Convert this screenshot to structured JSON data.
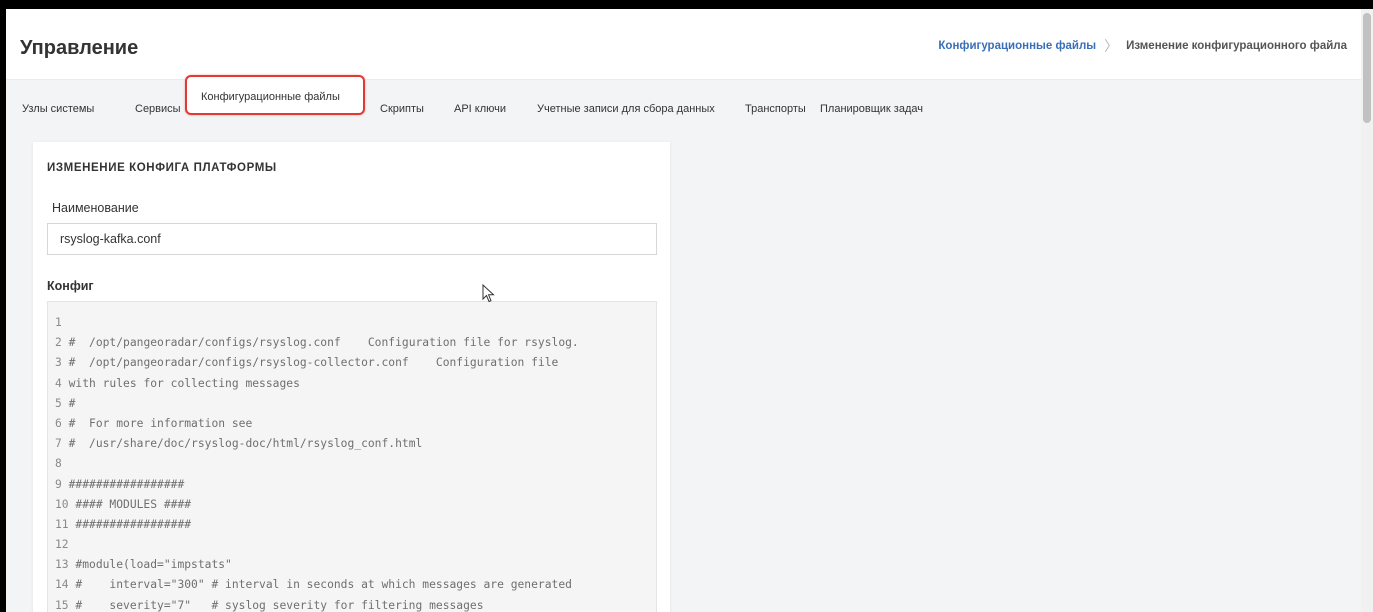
{
  "header": {
    "title": "Управление",
    "breadcrumb": {
      "link": "Конфигурационные файлы",
      "current": "Изменение конфигурационного файла"
    }
  },
  "tabs": [
    {
      "label": "Узлы системы"
    },
    {
      "label": "Сервисы"
    },
    {
      "label": "Конфигурационные файлы",
      "active": true
    },
    {
      "label": "Скрипты"
    },
    {
      "label": "API ключи"
    },
    {
      "label": "Учетные записи для сбора данных"
    },
    {
      "label": "Транспорты"
    },
    {
      "label": "Планировщик задач"
    }
  ],
  "card": {
    "title": "ИЗМЕНЕНИЕ КОНФИГА ПЛАТФОРМЫ",
    "name_label": "Наименование",
    "name_value": "rsyslog-kafka.conf",
    "config_label": "Конфиг"
  },
  "code": [
    {
      "n": "1",
      "text": ""
    },
    {
      "n": "2",
      "text": "#  /opt/pangeoradar/configs/rsyslog.conf    Configuration file for rsyslog."
    },
    {
      "n": "3",
      "text": "#  /opt/pangeoradar/configs/rsyslog-collector.conf    Configuration file"
    },
    {
      "n": "4",
      "text": "with rules for collecting messages"
    },
    {
      "n": "5",
      "text": "#"
    },
    {
      "n": "6",
      "text": "#  For more information see"
    },
    {
      "n": "7",
      "text": "#  /usr/share/doc/rsyslog-doc/html/rsyslog_conf.html"
    },
    {
      "n": "8",
      "text": ""
    },
    {
      "n": "9",
      "text": "#################"
    },
    {
      "n": "10",
      "text": "#### MODULES ####"
    },
    {
      "n": "11",
      "text": "#################"
    },
    {
      "n": "12",
      "text": ""
    },
    {
      "n": "13",
      "text": "#module(load=\"impstats\""
    },
    {
      "n": "14",
      "text": "#    interval=\"300\" # interval in seconds at which messages are generated"
    },
    {
      "n": "15",
      "text": "#    severity=\"7\"   # syslog severity for filtering messages"
    }
  ],
  "colors": {
    "accent": "#3a6fb7",
    "highlight": "#e03a34",
    "background": "#f3f4f5"
  }
}
